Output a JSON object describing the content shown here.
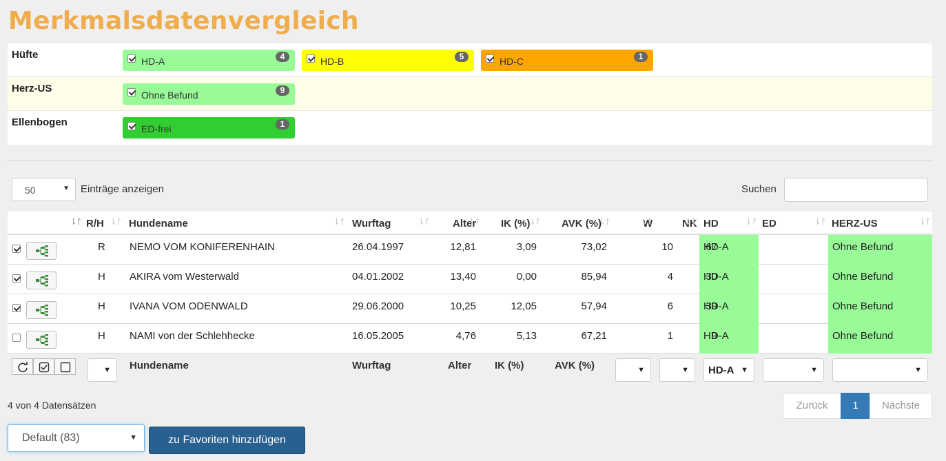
{
  "title": "Merkmalsdatenvergleich",
  "features": [
    {
      "label": "Hüfte",
      "chips": [
        {
          "label": "HD-A",
          "count": "4",
          "checked": true,
          "color": "#98fb98"
        },
        {
          "label": "HD-B",
          "count": "5",
          "checked": true,
          "color": "#ffff00"
        },
        {
          "label": "HD-C",
          "count": "1",
          "checked": true,
          "color": "#ffa500"
        }
      ]
    },
    {
      "label": "Herz-US",
      "chips": [
        {
          "label": "Ohne Befund",
          "count": "9",
          "checked": true,
          "color": "#98fb98"
        }
      ]
    },
    {
      "label": "Ellenbogen",
      "chips": [
        {
          "label": "ED-frei",
          "count": "1",
          "checked": true,
          "color": "#32cd32"
        }
      ]
    }
  ],
  "controls": {
    "length_value": "50",
    "length_label": "Einträge anzeigen",
    "search_label": "Suchen",
    "search_value": ""
  },
  "table": {
    "headers": {
      "rh": "R/H",
      "name": "Hundename",
      "wurftag": "Wurftag",
      "alter": "Alter",
      "ik": "IK (%)",
      "avk": "AVK (%)",
      "w": "W",
      "nk": "NK",
      "hd": "HD",
      "ed": "ED",
      "herz": "HERZ-US"
    },
    "rows": [
      {
        "checked": true,
        "rh": "R",
        "name": "NEMO VOM KONIFERENHAIN",
        "wurftag": "26.04.1997",
        "alter": "12,81",
        "ik": "3,09",
        "avk": "73,02",
        "w": "10",
        "nk": "67",
        "hd": "HD-A",
        "ed": "",
        "herz": "Ohne Befund"
      },
      {
        "checked": true,
        "rh": "H",
        "name": "AKIRA vom Westerwald",
        "wurftag": "04.01.2002",
        "alter": "13,40",
        "ik": "0,00",
        "avk": "85,94",
        "w": "4",
        "nk": "30",
        "hd": "HD-A",
        "ed": "",
        "herz": "Ohne Befund"
      },
      {
        "checked": true,
        "rh": "H",
        "name": "IVANA VOM ODENWALD",
        "wurftag": "29.06.2000",
        "alter": "10,25",
        "ik": "12,05",
        "avk": "57,94",
        "w": "6",
        "nk": "39",
        "hd": "HD-A",
        "ed": "",
        "herz": "Ohne Befund"
      },
      {
        "checked": false,
        "rh": "H",
        "name": "NAMI von der Schlehhecke",
        "wurftag": "16.05.2005",
        "alter": "4,76",
        "ik": "5,13",
        "avk": "67,21",
        "w": "1",
        "nk": "9",
        "hd": "HD-A",
        "ed": "",
        "herz": "Ohne Befund"
      }
    ],
    "filters": {
      "name": "Hundename",
      "wurftag": "Wurftag",
      "alter": "Alter",
      "ik": "IK (%)",
      "avk": "AVK (%)",
      "hd_value": "HD-A"
    }
  },
  "info": "4 von 4 Datensätzen",
  "pager": {
    "prev": "Zurück",
    "page": "1",
    "next": "Nächste"
  },
  "preset_value": "Default (83)",
  "fav_button": "zu Favoriten hinzufügen",
  "colors": {
    "title": "#f0ad4e",
    "cell_green": "#98fb98",
    "primary": "#286090"
  },
  "icons": [
    "tree-icon",
    "refresh-icon",
    "check-all-icon",
    "uncheck-all-icon",
    "sort-icon"
  ]
}
